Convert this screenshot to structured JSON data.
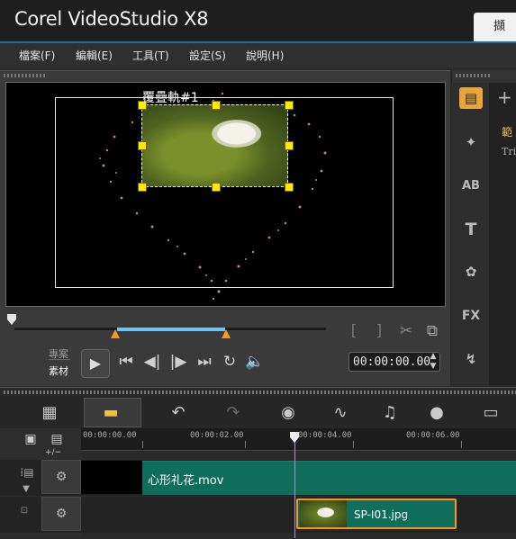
{
  "window": {
    "title": "Corel  VideoStudio X8",
    "tab_partial": "擷"
  },
  "menu": [
    {
      "label": "檔案(F)"
    },
    {
      "label": "編輯(E)"
    },
    {
      "label": "工具(T)"
    },
    {
      "label": "設定(S)"
    },
    {
      "label": "說明(H)"
    }
  ],
  "player": {
    "overlay_label": "覆疊軌#1",
    "mode_project": "專案",
    "mode_clip": "素材",
    "timecode": "00:00:00.00",
    "scrub_position": 0,
    "trim_range": [
      0.33,
      0.67
    ],
    "icons": {
      "play": "play-icon",
      "home": "go-to-start-icon",
      "prev_frame": "previous-frame-icon",
      "next_frame": "next-frame-icon",
      "end": "go-to-end-icon",
      "repeat": "repeat-icon",
      "volume": "volume-icon",
      "mark_in": "mark-in-icon",
      "mark_out": "mark-out-icon",
      "split": "scissors-icon",
      "enlarge": "enlarge-icon"
    }
  },
  "library": {
    "add_label": "+",
    "text_1": "範",
    "text_2": "Tri",
    "icons": [
      "media-icon",
      "instant-project-icon",
      "transition-icon",
      "title-icon",
      "graphic-icon",
      "filter-icon",
      "path-icon"
    ],
    "icon_glyphs": [
      "▤",
      "✦",
      "AB",
      "T",
      "✿",
      "FX",
      "↯"
    ]
  },
  "timeline": {
    "toolbar_icons": [
      "storyboard-view-icon",
      "timeline-view-icon",
      "undo-icon",
      "redo-icon",
      "record-capture-icon",
      "sound-mixer-icon",
      "auto-music-icon",
      "motion-tracking-icon",
      "subtitle-editor-icon"
    ],
    "ruler": [
      "00:00:00.00",
      "00:00:02.00",
      "00:00:04.00",
      "00:00:06.00"
    ],
    "zoom_label": "+/−",
    "tracks": [
      {
        "clip_label": "心形礼花.mov"
      },
      {
        "clip_label": "SP-I01.jpg"
      }
    ]
  }
}
